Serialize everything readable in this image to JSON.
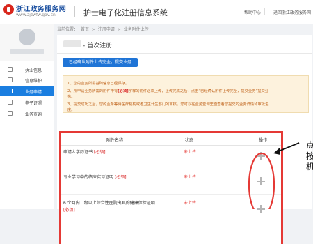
{
  "header": {
    "brand": "浙江政务服务网",
    "brand_url": "www.zjzwfw.gov.cn",
    "system_title": "护士电子化注册信息系统",
    "links": [
      "帮助中心",
      "退回浙江政务服务网"
    ]
  },
  "sidebar": {
    "items": [
      {
        "label": "执业信息",
        "icon": "license-icon"
      },
      {
        "label": "信息维护",
        "icon": "edit-icon"
      },
      {
        "label": "业务申请",
        "icon": "apply-icon",
        "active": true
      },
      {
        "label": "电子证照",
        "icon": "certificate-icon"
      },
      {
        "label": "业务查询",
        "icon": "query-icon"
      }
    ],
    "active_color": "#1a7ee0"
  },
  "breadcrumb": [
    "当前位置：",
    "首页",
    ">",
    "注册申请",
    ">",
    "业务附件上传"
  ],
  "page": {
    "title": "- 首次注册",
    "confirm_button": "已经确认附件上传完全，提交业务"
  },
  "notice": {
    "line1": "1、您的业务所需基础信息已经保存。",
    "line2_a": "2、所申请业务所需的附件带有",
    "line2_req": "[必须]",
    "line2_b": "字样的附件必须上传，上传完成之后，点击“已经确认附件上传完全，提交业务”提交业",
    "line2_c": "务。",
    "line3": "3、提交成功之后，您的业务等待医疗机构或者卫生计生部门的审核，您可以在业务查询里面查看您提交的业务详情和审批进",
    "line3_c": "度。"
  },
  "table": {
    "headers": [
      "附件名称",
      "状态",
      "操作"
    ],
    "rows": [
      {
        "name": "申请人学历证书",
        "required": "[必须]",
        "status": "未上传"
      },
      {
        "name": "专业学习中的临床实习证明",
        "required": "[必须]",
        "status": "未上传"
      },
      {
        "name": "6 个月内二级以上综合性医院出具的健康体检证明",
        "required": "[必须]",
        "status": "未上传"
      }
    ]
  },
  "annotation": {
    "chars": [
      "点",
      "按",
      "机"
    ]
  },
  "colors": {
    "brand_blue": "#1a4fa0",
    "primary": "#1f74d6",
    "notice_bg": "#fdf2dd",
    "notice_text": "#c0641c",
    "required_red": "#d82020",
    "highlight_border": "#e53935"
  }
}
